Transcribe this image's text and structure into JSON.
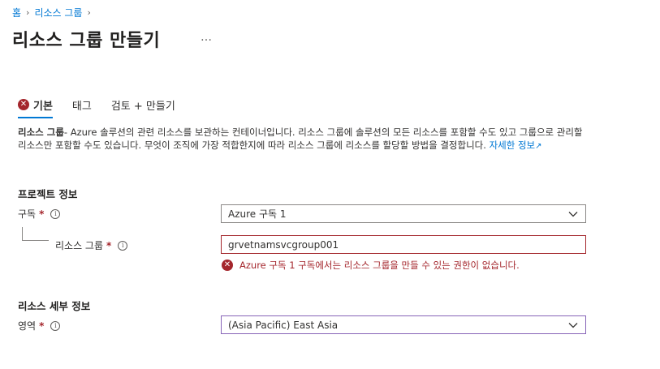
{
  "breadcrumb": {
    "home": "홈",
    "resource_groups": "리소스 그룹"
  },
  "page": {
    "title": "리소스 그룹 만들기",
    "more": "…"
  },
  "tabs": [
    {
      "label": "기본"
    },
    {
      "label": "태그"
    },
    {
      "label": "검토 + 만들기"
    }
  ],
  "description": {
    "bold": "리소스 그룹",
    "text": "- Azure 솔루션의 관련 리소스를 보관하는 컨테이너입니다. 리소스 그룹에 솔루션의 모든 리소스를 포함할 수도 있고 그룹으로 관리할 리소스만 포함할 수도 있습니다. 무엇이 조직에 가장 적합한지에 따라 리소스 그룹에 리소스를 할당할 방법을 결정합니다. ",
    "link": "자세한 정보"
  },
  "project": {
    "title": "프로젝트 정보",
    "subscription_label": "구독",
    "subscription_value": "Azure 구독 1",
    "resource_group_label": "리소스 그룹",
    "resource_group_value": "grvetnamsvcgroup001",
    "error": "Azure 구독 1 구독에서는 리소스 그룹을 만들 수 있는 권한이 없습니다."
  },
  "resource_details": {
    "title": "리소스 세부 정보",
    "region_label": "영역",
    "region_value": "(Asia Pacific) East Asia"
  },
  "required_mark": "*",
  "info_glyph": "i",
  "colors": {
    "accent": "#0078d4",
    "error": "#a4262c",
    "focus": "#8764b8"
  }
}
